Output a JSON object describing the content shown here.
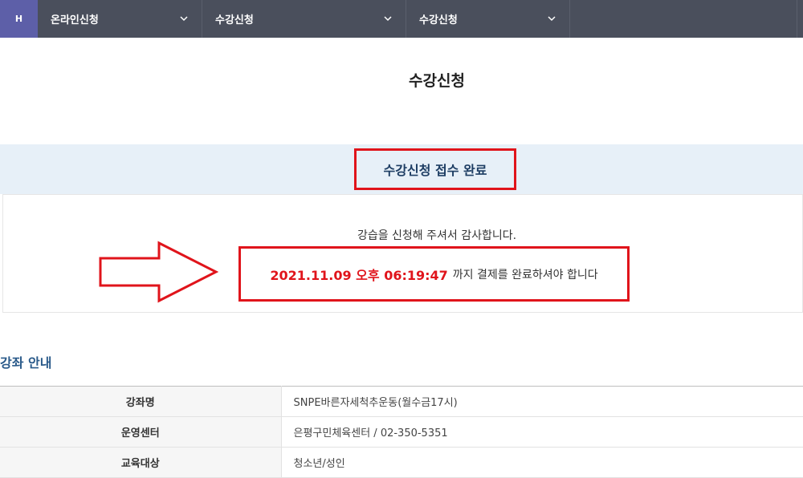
{
  "nav": {
    "home_label": "H",
    "items": [
      {
        "label": "온라인신청"
      },
      {
        "label": "수강신청"
      },
      {
        "label": "수강신청"
      }
    ]
  },
  "page_title": "수강신청",
  "banner": {
    "title": "수강신청 접수 완료"
  },
  "message": {
    "thanks": "강습을 신청해 주셔서 감사합니다.",
    "deadline_time": "2021.11.09 오후 06:19:47",
    "deadline_suffix": "까지 결제를 완료하셔야 합니다"
  },
  "course_info": {
    "title": "강좌 안내",
    "rows": [
      {
        "label": "강좌명",
        "value": "SNPE바른자세척추운동(월수금17시)"
      },
      {
        "label": "운영센터",
        "value": "은평구민체육센터 / 02-350-5351"
      },
      {
        "label": "교육대상",
        "value": "청소년/성인"
      }
    ]
  },
  "colors": {
    "nav_bg": "#4a4f5c",
    "home_bg": "#5d5fa8",
    "banner_bg": "#e7f0f8",
    "highlight_red": "#e0141b",
    "section_title": "#2a5a8a"
  },
  "icons": {
    "nav_chevron": "chevron-down-icon",
    "annotation_arrow": "right-arrow-icon"
  }
}
